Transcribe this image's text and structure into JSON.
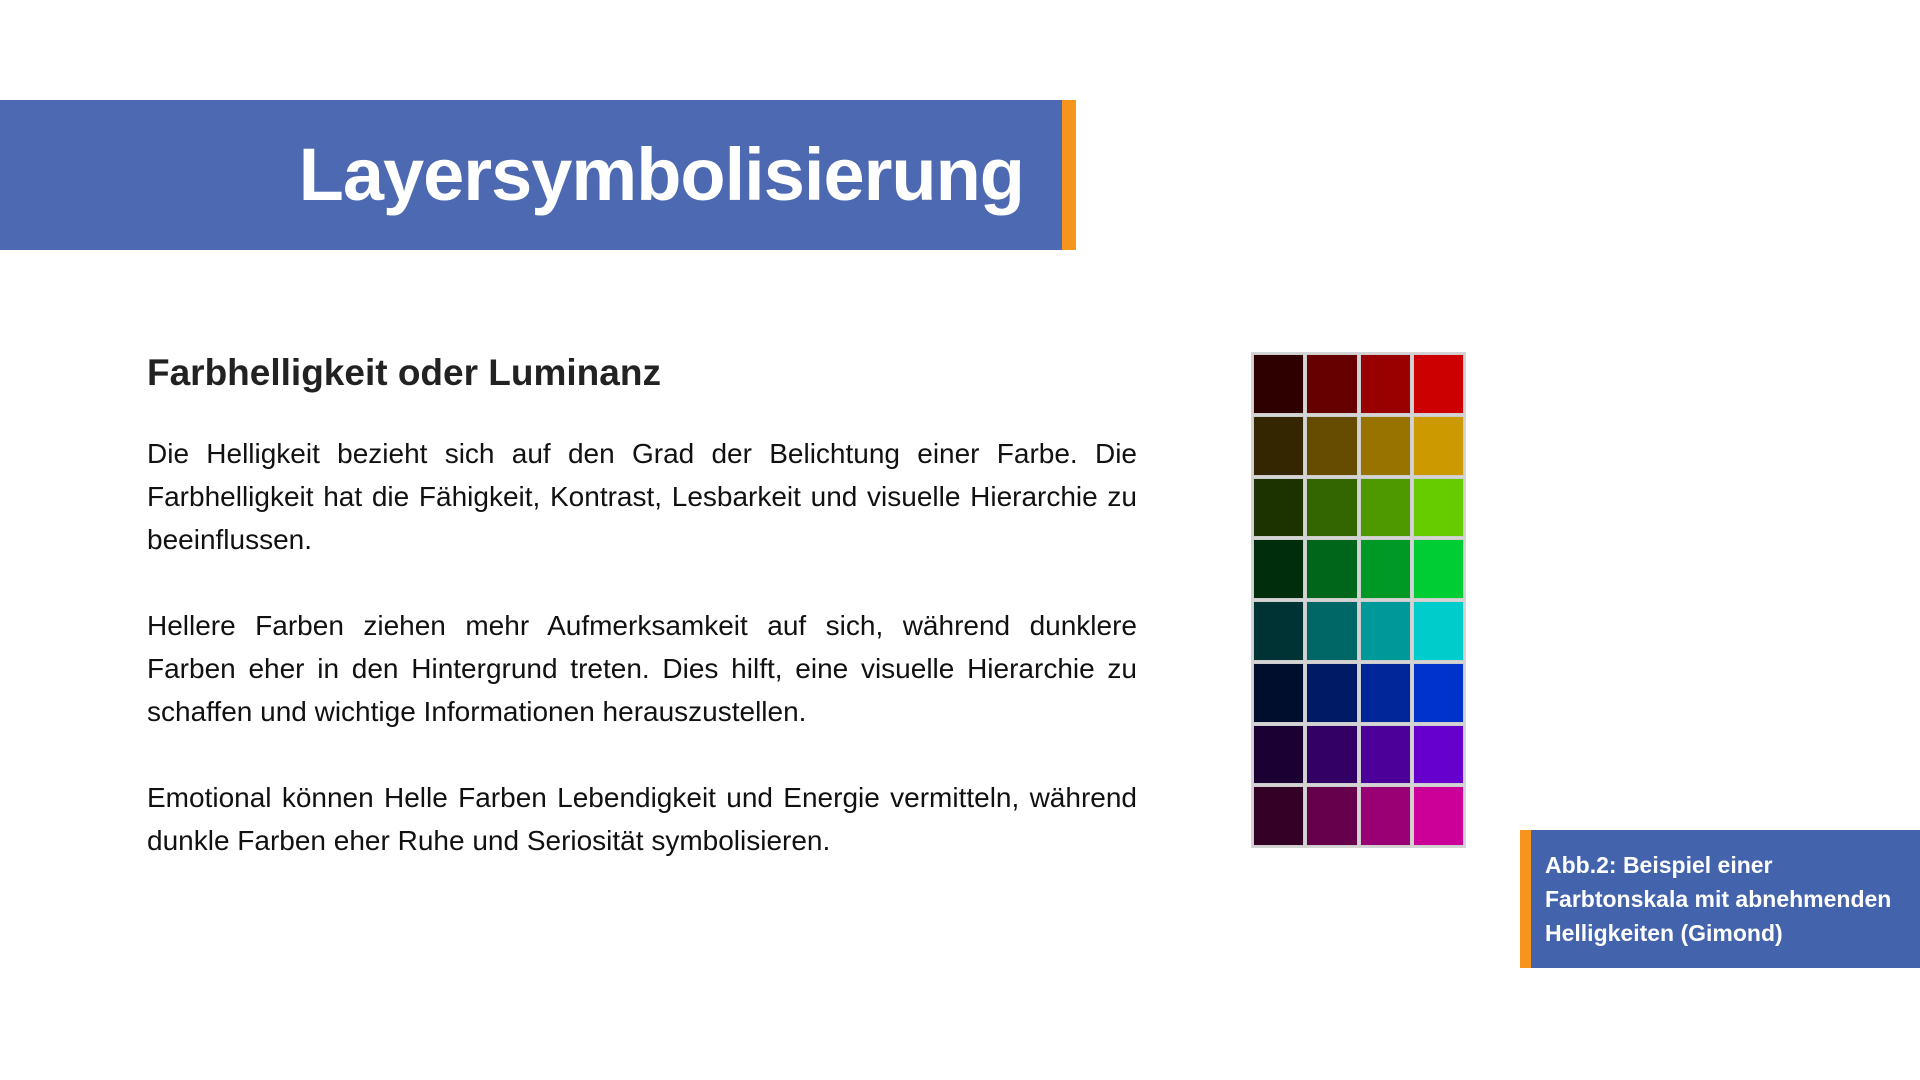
{
  "header": {
    "title": "Layersymbolisierung"
  },
  "content": {
    "heading": "Farbhelligkeit oder Luminanz",
    "paragraphs": [
      "Die Helligkeit bezieht sich auf den Grad der Belichtung einer Farbe. Die Farbhelligkeit hat die Fähigkeit, Kontrast, Lesbarkeit und visuelle Hierarchie zu beeinflussen.",
      "Hellere Farben ziehen mehr Aufmerksamkeit auf sich, während dunklere Farben eher in den Hintergrund treten. Dies hilft, eine visuelle Hierarchie zu schaffen und wichtige Informationen herauszustellen.",
      "Emotional können Helle Farben Lebendigkeit und Energie vermitteln, während dunkle Farben eher Ruhe und Seriosität symbolisieren."
    ]
  },
  "swatches": [
    [
      "#2e0000",
      "#660000",
      "#990000",
      "#cc0000"
    ],
    [
      "#332600",
      "#664c00",
      "#997300",
      "#cc9900"
    ],
    [
      "#1c3300",
      "#336600",
      "#4f9900",
      "#66cc00"
    ],
    [
      "#002e0c",
      "#006619",
      "#009926",
      "#00cc33"
    ],
    [
      "#003333",
      "#006666",
      "#009999",
      "#00cccc"
    ],
    [
      "#000e2e",
      "#001a66",
      "#002699",
      "#0033cc"
    ],
    [
      "#1a0033",
      "#330066",
      "#4d0099",
      "#6600cc"
    ],
    [
      "#330026",
      "#66004c",
      "#990073",
      "#cc0099"
    ]
  ],
  "caption": {
    "text": "Abb.2: Beispiel einer Farbtonskala mit abnehmenden Helligkeiten (Gimond)"
  },
  "colors": {
    "accent": "#f7941d",
    "bar": "#4d69b1"
  }
}
